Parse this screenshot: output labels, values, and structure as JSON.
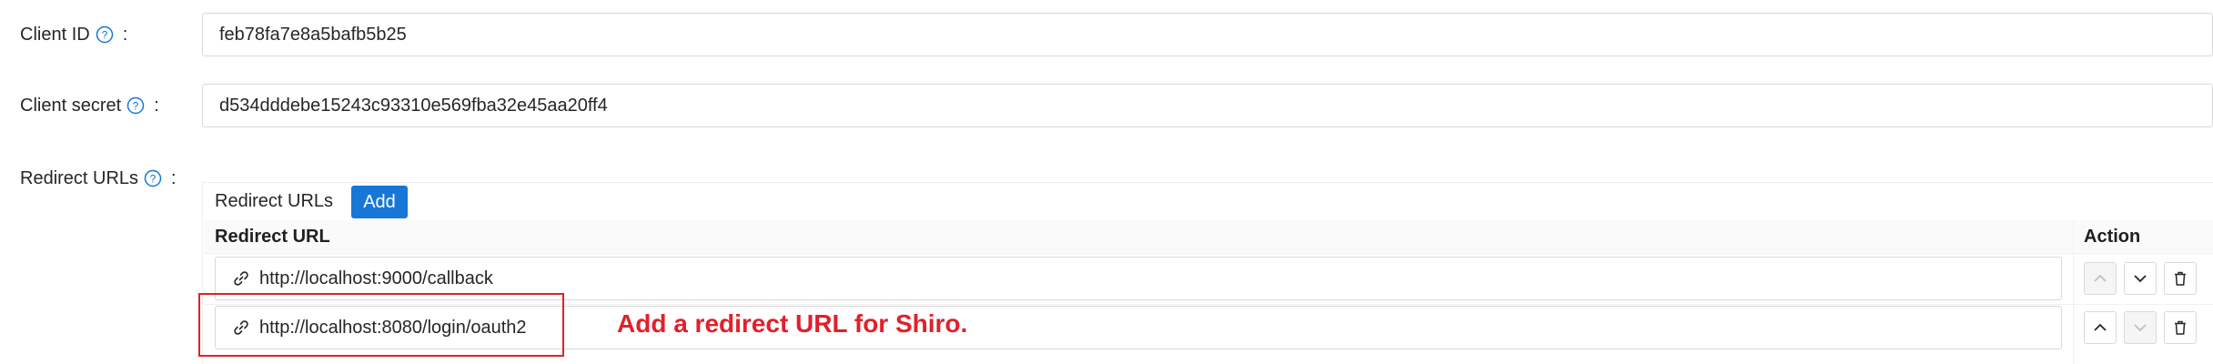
{
  "fields": {
    "client_id": {
      "label": "Client ID",
      "value": "feb78fa7e8a5bafb5b25"
    },
    "client_secret": {
      "label": "Client secret",
      "value": "d534dddebe15243c93310e569fba32e45aa20ff4"
    },
    "redirect_urls": {
      "label": "Redirect URLs"
    }
  },
  "colon": ":",
  "redirect_table": {
    "toolbar_title": "Redirect URLs",
    "add_label": "Add",
    "col_url": "Redirect URL",
    "col_action": "Action",
    "rows": [
      {
        "url": "http://localhost:9000/callback"
      },
      {
        "url": "http://localhost:8080/login/oauth2"
      }
    ]
  },
  "annotation": {
    "text": "Add a redirect URL for Shiro."
  },
  "colors": {
    "accent": "#1677d6",
    "annotation": "#e0212b",
    "border": "#d9d9d9"
  },
  "icons": [
    "question-circle-icon",
    "link-icon",
    "arrow-up-icon",
    "arrow-down-icon",
    "delete-icon"
  ]
}
